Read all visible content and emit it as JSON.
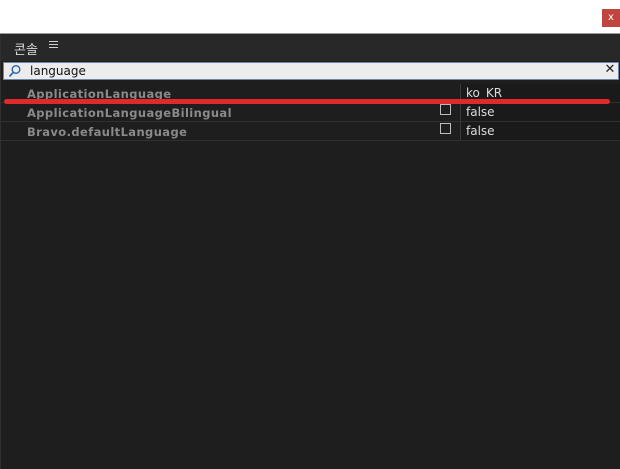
{
  "window": {
    "close_label": "x"
  },
  "console": {
    "title": "콘솔",
    "search": {
      "value": "language",
      "clear_label": "✕"
    },
    "rows": [
      {
        "name": "ApplicationLanguage",
        "value": "ko_KR"
      },
      {
        "name": "ApplicationLanguageBilingual",
        "value": "false"
      },
      {
        "name": "Bravo.defaultLanguage",
        "value": "false"
      }
    ]
  },
  "annotation_color": "#e02a2a"
}
